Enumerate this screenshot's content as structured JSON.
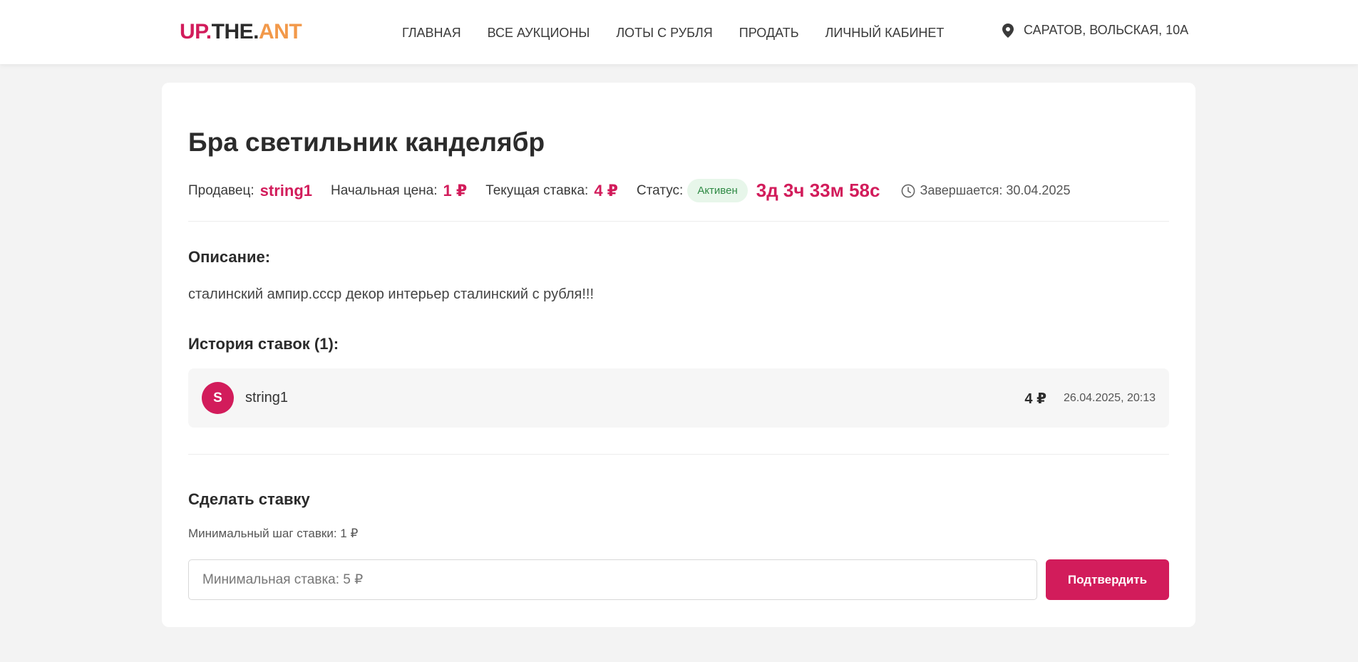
{
  "header": {
    "logo": {
      "part1": "UP.",
      "part2": "THE.",
      "part3": "ANT"
    },
    "nav": [
      {
        "label": "ГЛАВНАЯ"
      },
      {
        "label": "ВСЕ АУКЦИОНЫ"
      },
      {
        "label": "ЛОТЫ С РУБЛЯ"
      },
      {
        "label": "ПРОДАТЬ"
      },
      {
        "label": "ЛИЧНЫЙ КАБИНЕТ"
      }
    ],
    "location": "САРАТОВ, ВОЛЬСКАЯ, 10А",
    "location_icon": "map-pin-icon"
  },
  "lot": {
    "title": "Бра светильник канделябр",
    "seller_label": "Продавец:",
    "seller": "string1",
    "start_price_label": "Начальная цена:",
    "start_price": "1 ₽",
    "current_bid_label": "Текущая ставка:",
    "current_bid": "4 ₽",
    "status_label": "Статус:",
    "status": "Активен",
    "countdown": "3д 3ч 33м 58с",
    "ends": "Завершается: 30.04.2025",
    "ends_icon": "clock-icon"
  },
  "description": {
    "heading": "Описание:",
    "text": "сталинский ампир.ссср декор интерьер сталинский с рубля!!!"
  },
  "history": {
    "heading": "История ставок (1):",
    "bids": [
      {
        "avatar": "S",
        "user": "string1",
        "amount": "4 ₽",
        "date": "26.04.2025, 20:13"
      }
    ]
  },
  "place_bid": {
    "heading": "Сделать ставку",
    "min_step": "Минимальный шаг ставки: 1 ₽",
    "input_placeholder": "Минимальная ставка: 5 ₽",
    "input_value": "",
    "submit_label": "Подтвердить"
  },
  "colors": {
    "accent": "#d21c5b",
    "logo_orange": "#f2994a",
    "status_bg": "#e7f6ea",
    "status_text": "#2f8a45"
  }
}
